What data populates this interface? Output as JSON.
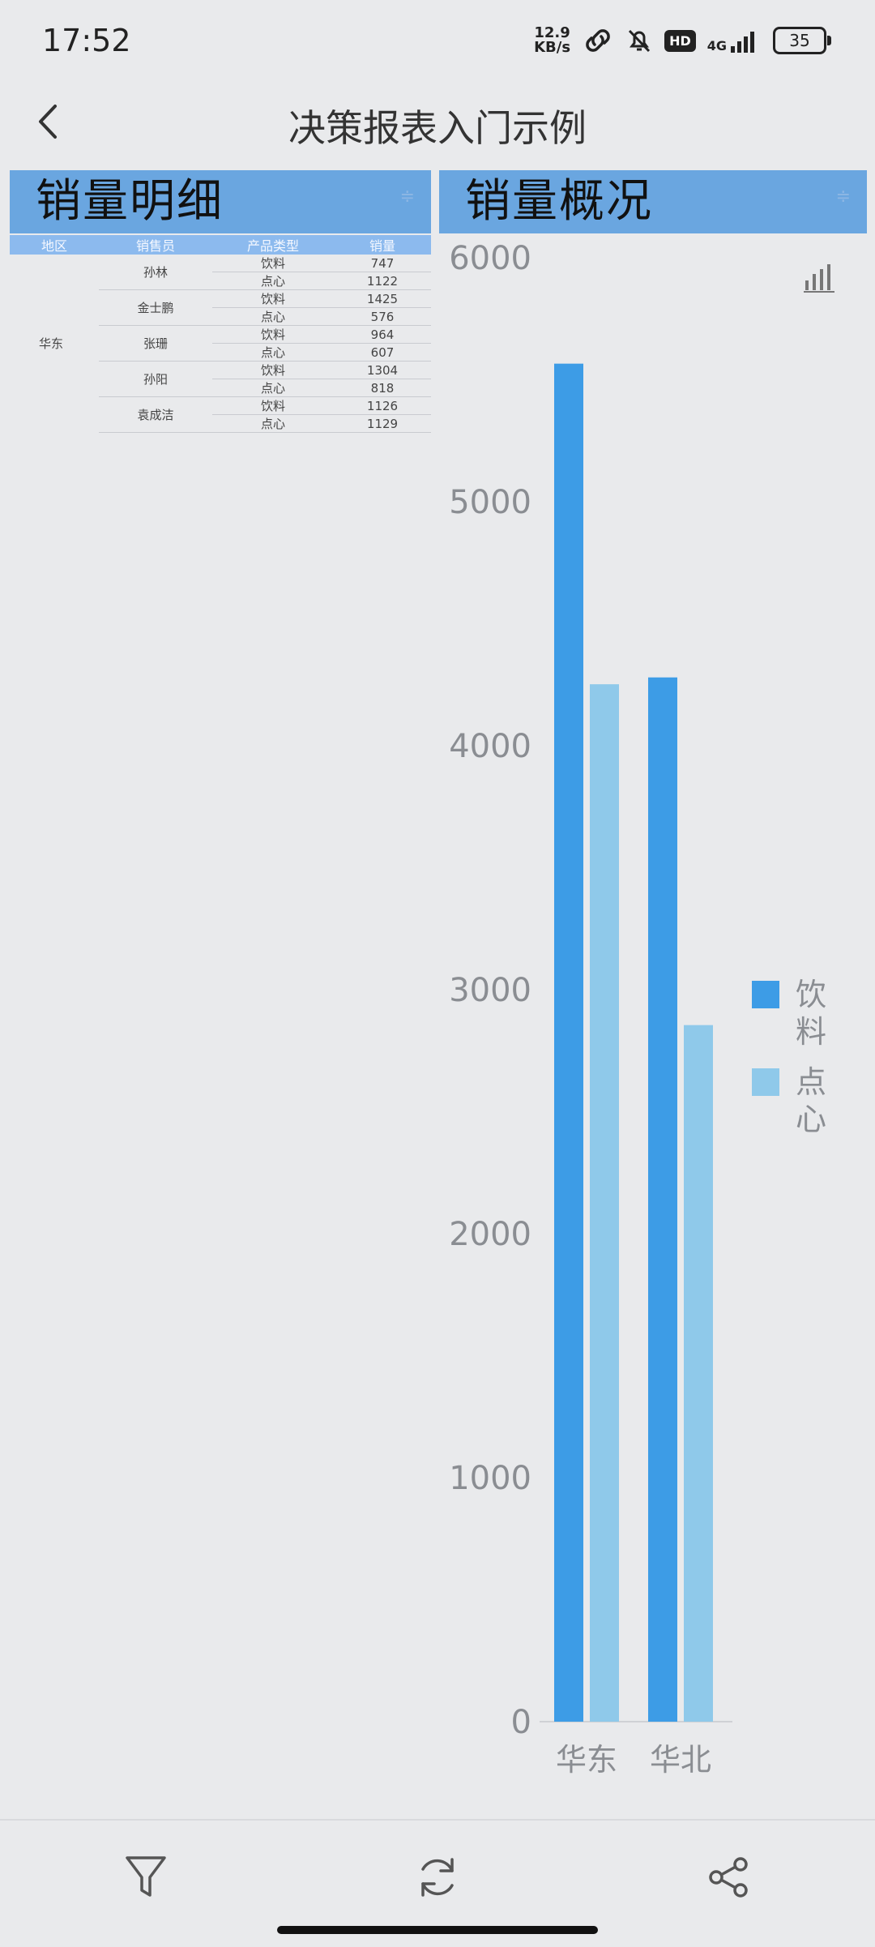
{
  "status_bar": {
    "time": "17:52",
    "speed_value": "12.9",
    "speed_unit": "KB/s",
    "hd_label": "HD",
    "network": "4G",
    "battery": "35"
  },
  "title_bar": {
    "title": "决策报表入门示例"
  },
  "panels": {
    "detail_title": "销量明细",
    "overview_title": "销量概况",
    "more_symbol": "≑"
  },
  "table": {
    "headers": [
      "地区",
      "销售员",
      "产品类型",
      "销量"
    ],
    "region": "华东",
    "rows": [
      {
        "seller": "孙林",
        "items": [
          {
            "type": "饮料",
            "qty": "747"
          },
          {
            "type": "点心",
            "qty": "1122"
          }
        ]
      },
      {
        "seller": "金士鹏",
        "items": [
          {
            "type": "饮料",
            "qty": "1425"
          },
          {
            "type": "点心",
            "qty": "576"
          }
        ]
      },
      {
        "seller": "张珊",
        "items": [
          {
            "type": "饮料",
            "qty": "964"
          },
          {
            "type": "点心",
            "qty": "607"
          }
        ]
      },
      {
        "seller": "孙阳",
        "items": [
          {
            "type": "饮料",
            "qty": "1304"
          },
          {
            "type": "点心",
            "qty": "818"
          }
        ]
      },
      {
        "seller": "袁成洁",
        "items": [
          {
            "type": "饮料",
            "qty": "1126"
          },
          {
            "type": "点心",
            "qty": "1129"
          }
        ]
      }
    ]
  },
  "chart_data": {
    "type": "bar",
    "title": "销量概况",
    "categories": [
      "华东",
      "华北"
    ],
    "series": [
      {
        "name": "饮料",
        "values": [
          5566,
          4280
        ]
      },
      {
        "name": "点心",
        "values": [
          4252,
          2855
        ]
      }
    ],
    "ylim": [
      0,
      6000
    ],
    "yticks": [
      0,
      1000,
      2000,
      3000,
      4000,
      5000,
      6000
    ],
    "legend": "right",
    "grid": false,
    "colors": [
      "#3d9ce6",
      "#8fc9ea"
    ]
  },
  "icons": {
    "back": "chevron-left-icon",
    "filter": "filter-icon",
    "refresh": "refresh-icon",
    "share": "share-icon",
    "chart_type": "bar-chart-icon"
  }
}
